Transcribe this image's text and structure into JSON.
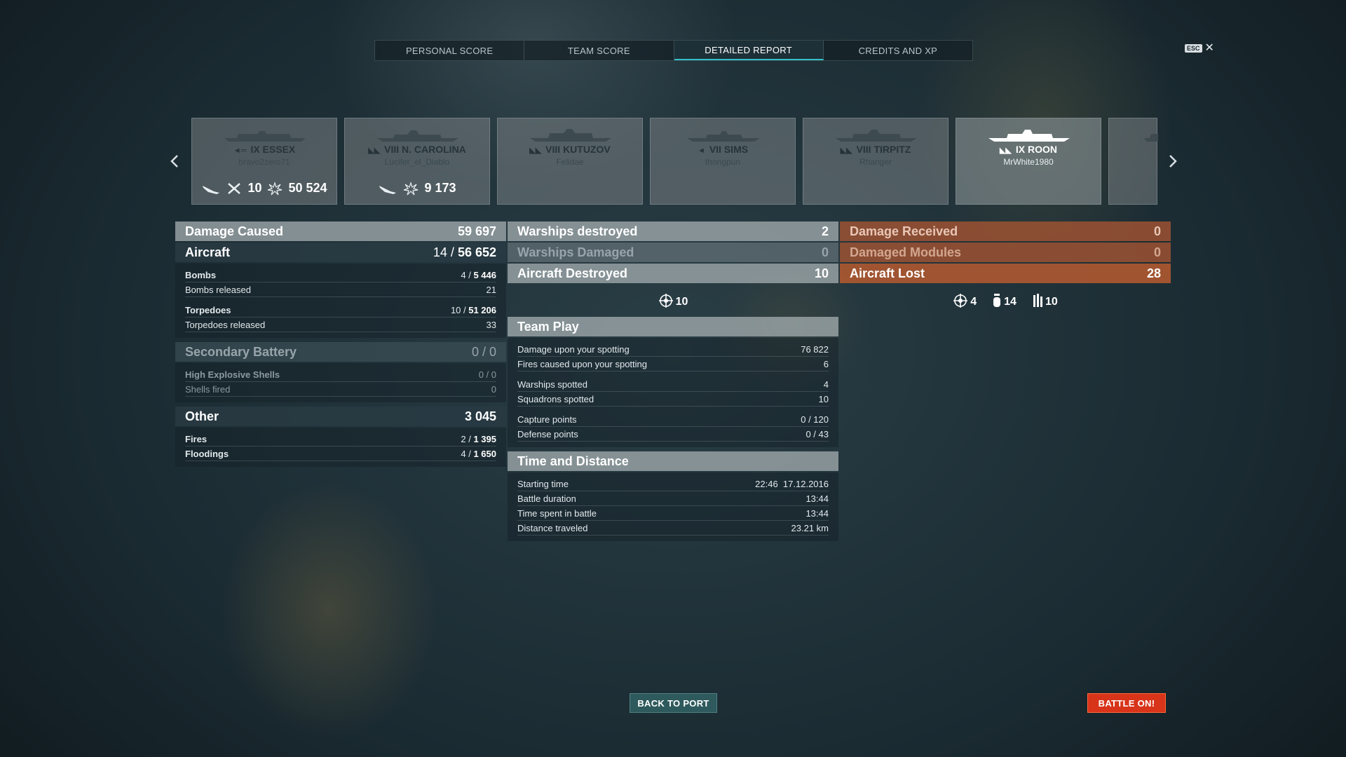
{
  "tabs": [
    "PERSONAL SCORE",
    "TEAM SCORE",
    "DETAILED REPORT",
    "CREDITS AND XP"
  ],
  "esc": {
    "key": "ESC",
    "close": "✕"
  },
  "ships": [
    {
      "tier_name": "IX ESSEX",
      "player": "bravo2zero71",
      "icon": "carrier-class-icon",
      "stats": {
        "aircraft": "10",
        "damage": "50 524"
      }
    },
    {
      "tier_name": "VIII N. CAROLINA",
      "player": "Lucifer_el_Diablo",
      "icon": "battleship-class-icon",
      "stats": {
        "damage": "9 173"
      }
    },
    {
      "tier_name": "VIII KUTUZOV",
      "player": "Felidae",
      "icon": "battleship-class-icon"
    },
    {
      "tier_name": "VII SIMS",
      "player": "thongpun",
      "icon": "destroyer-class-icon"
    },
    {
      "tier_name": "VIII TIRPITZ",
      "player": "Rhanger",
      "icon": "battleship-class-icon"
    },
    {
      "tier_name": "IX ROON",
      "player": "MrWhite1980",
      "icon": "cruiser-class-icon"
    }
  ],
  "damage_caused": {
    "title": "Damage Caused",
    "total": "59 697",
    "aircraft": {
      "title": "Aircraft",
      "value_a": "14 / ",
      "value_b": "56 652"
    },
    "bombs": {
      "label": "Bombs",
      "a": "4 / ",
      "b": "5 446"
    },
    "bombs_released": {
      "label": "Bombs released",
      "value": "21"
    },
    "torpedoes": {
      "label": "Torpedoes",
      "a": "10 / ",
      "b": "51 206"
    },
    "torpedoes_released": {
      "label": "Torpedoes released",
      "value": "33"
    },
    "secondary": {
      "title": "Secondary Battery",
      "value": "0 / 0"
    },
    "he_shells": {
      "label": "High Explosive Shells",
      "value": "0 / 0"
    },
    "shells_fired": {
      "label": "Shells fired",
      "value": "0"
    },
    "other": {
      "title": "Other",
      "value": "3 045"
    },
    "fires": {
      "label": "Fires",
      "a": "2 / ",
      "b": "1 395"
    },
    "floodings": {
      "label": "Floodings",
      "a": "4 / ",
      "b": "1 650"
    }
  },
  "middle": {
    "warships_destroyed": {
      "label": "Warships destroyed",
      "value": "2"
    },
    "warships_damaged": {
      "label": "Warships Damaged",
      "value": "0"
    },
    "aircraft_destroyed": {
      "label": "Aircraft Destroyed",
      "value": "10"
    },
    "aircraft_icon_count": "10",
    "team_play": {
      "title": "Team Play",
      "rows": [
        {
          "label": "Damage upon your spotting",
          "value": "76 822"
        },
        {
          "label": "Fires caused upon your spotting",
          "value": "6"
        },
        {
          "label": "Warships spotted",
          "value": "4"
        },
        {
          "label": "Squadrons spotted",
          "value": "10"
        },
        {
          "label": "Capture points",
          "value": "0 / 120"
        },
        {
          "label": "Defense points",
          "value": "0 / 43"
        }
      ]
    },
    "time_distance": {
      "title": "Time and Distance",
      "rows": [
        {
          "label": "Starting time",
          "value": "22:46  17.12.2016"
        },
        {
          "label": "Battle duration",
          "value": "13:44"
        },
        {
          "label": "Time spent in battle",
          "value": "13:44"
        },
        {
          "label": "Distance traveled",
          "value": "23.21 km"
        }
      ]
    }
  },
  "right": {
    "damage_received": {
      "label": "Damage Received",
      "value": "0"
    },
    "damaged_modules": {
      "label": "Damaged Modules",
      "value": "0"
    },
    "aircraft_lost": {
      "label": "Aircraft Lost",
      "value": "28"
    },
    "losses": {
      "fighters": "4",
      "bombers": "14",
      "torpedo": "10"
    }
  },
  "buttons": {
    "back_to_port": "BACK TO PORT",
    "battle_on": "BATTLE ON!"
  }
}
